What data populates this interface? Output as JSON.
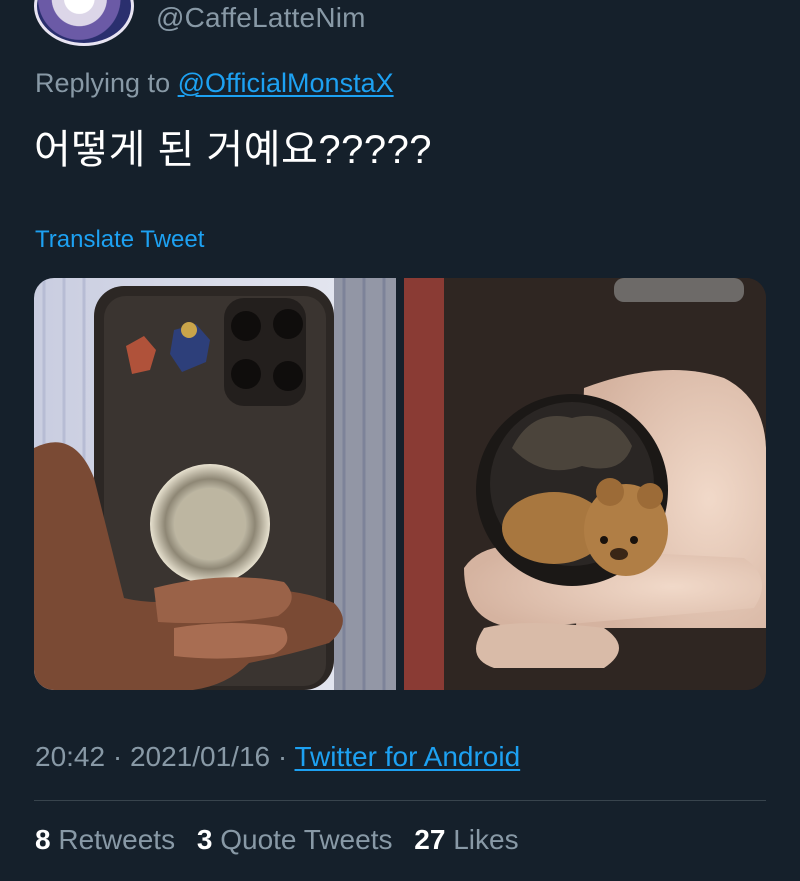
{
  "tweet": {
    "handle": "@CaffeLatteNim",
    "replying_prefix": "Replying to",
    "replying_to": "@OfficialMonstaX",
    "text": "어떻게 된 거예요?????",
    "translate_label": "Translate Tweet",
    "time": "20:42",
    "date": "2021/01/16",
    "separator": "·",
    "source": "Twitter for Android"
  },
  "stats": {
    "retweets_count": "8",
    "retweets_label": "Retweets",
    "quotes_count": "3",
    "quotes_label": "Quote Tweets",
    "likes_count": "27",
    "likes_label": "Likes"
  },
  "colors": {
    "background": "#15202b",
    "accent": "#1da1f2",
    "secondary_text": "#8899a6",
    "divider": "#38444d"
  }
}
